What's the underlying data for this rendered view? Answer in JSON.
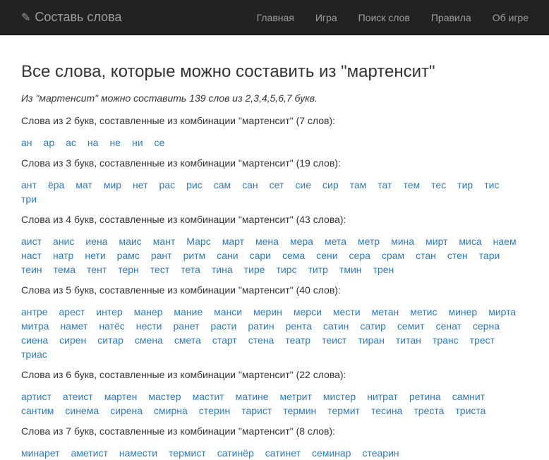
{
  "navbar": {
    "brand_icon": "pencil-icon",
    "brand": "Составь слова",
    "links": [
      "Главная",
      "Игра",
      "Поиск слов",
      "Правила",
      "Об игре"
    ]
  },
  "main": {
    "title": "Все слова, которые можно составить из \"мартенсит\"",
    "summary": "Из \"мартенсит\" можно составить 139 слов из 2,3,4,5,6,7 букв.",
    "groups": [
      {
        "title": "Слова из 2 букв, составленные из комбинации \"мартенсит\" (7 слов):",
        "words": [
          "ан",
          "ар",
          "ас",
          "на",
          "не",
          "ни",
          "се"
        ]
      },
      {
        "title": "Слова из 3 букв, составленные из комбинации \"мартенсит\" (19 слов):",
        "words": [
          "ант",
          "ёра",
          "мат",
          "мир",
          "нет",
          "рас",
          "рис",
          "сам",
          "сан",
          "сет",
          "сие",
          "сир",
          "там",
          "тат",
          "тем",
          "тес",
          "тир",
          "тис",
          "три"
        ]
      },
      {
        "title": "Слова из 4 букв, составленные из комбинации \"мартенсит\" (43 слова):",
        "words": [
          "аист",
          "анис",
          "иена",
          "маис",
          "мант",
          "Марс",
          "март",
          "мена",
          "мера",
          "мета",
          "метр",
          "мина",
          "мирт",
          "миса",
          "наем",
          "наст",
          "натр",
          "нети",
          "рамс",
          "рант",
          "ритм",
          "сани",
          "сари",
          "сема",
          "сени",
          "сера",
          "срам",
          "стан",
          "стен",
          "тари",
          "теин",
          "тема",
          "тент",
          "терн",
          "тест",
          "тета",
          "тина",
          "тире",
          "тирс",
          "титр",
          "тмин",
          "трен"
        ]
      },
      {
        "title": "Слова из 5 букв, составленные из комбинации \"мартенсит\" (40 слов):",
        "words": [
          "антре",
          "арест",
          "интер",
          "манер",
          "мание",
          "манси",
          "мерин",
          "мерси",
          "мести",
          "метан",
          "метис",
          "минер",
          "мирта",
          "митра",
          "намет",
          "натёс",
          "нести",
          "ранет",
          "расти",
          "ратин",
          "рента",
          "сатин",
          "сатир",
          "семит",
          "сенат",
          "серна",
          "сиена",
          "сирен",
          "ситар",
          "смена",
          "смета",
          "старт",
          "стена",
          "театр",
          "теист",
          "тиран",
          "титан",
          "транс",
          "трест",
          "триас"
        ]
      },
      {
        "title": "Слова из 6 букв, составленные из комбинации \"мартенсит\" (22 слова):",
        "words": [
          "артист",
          "атеист",
          "мартен",
          "мастер",
          "мастит",
          "матине",
          "метрит",
          "мистер",
          "нитрат",
          "ретина",
          "самнит",
          "сантим",
          "синема",
          "сирена",
          "смирна",
          "стерин",
          "тарист",
          "термин",
          "термит",
          "тесина",
          "треста",
          "триста"
        ]
      },
      {
        "title": "Слова из 7 букв, составленные из комбинации \"мартенсит\" (8 слов):",
        "words": [
          "минарет",
          "аметист",
          "намести",
          "термист",
          "сатинёр",
          "сатинет",
          "семинар",
          "стеарин"
        ]
      }
    ]
  }
}
